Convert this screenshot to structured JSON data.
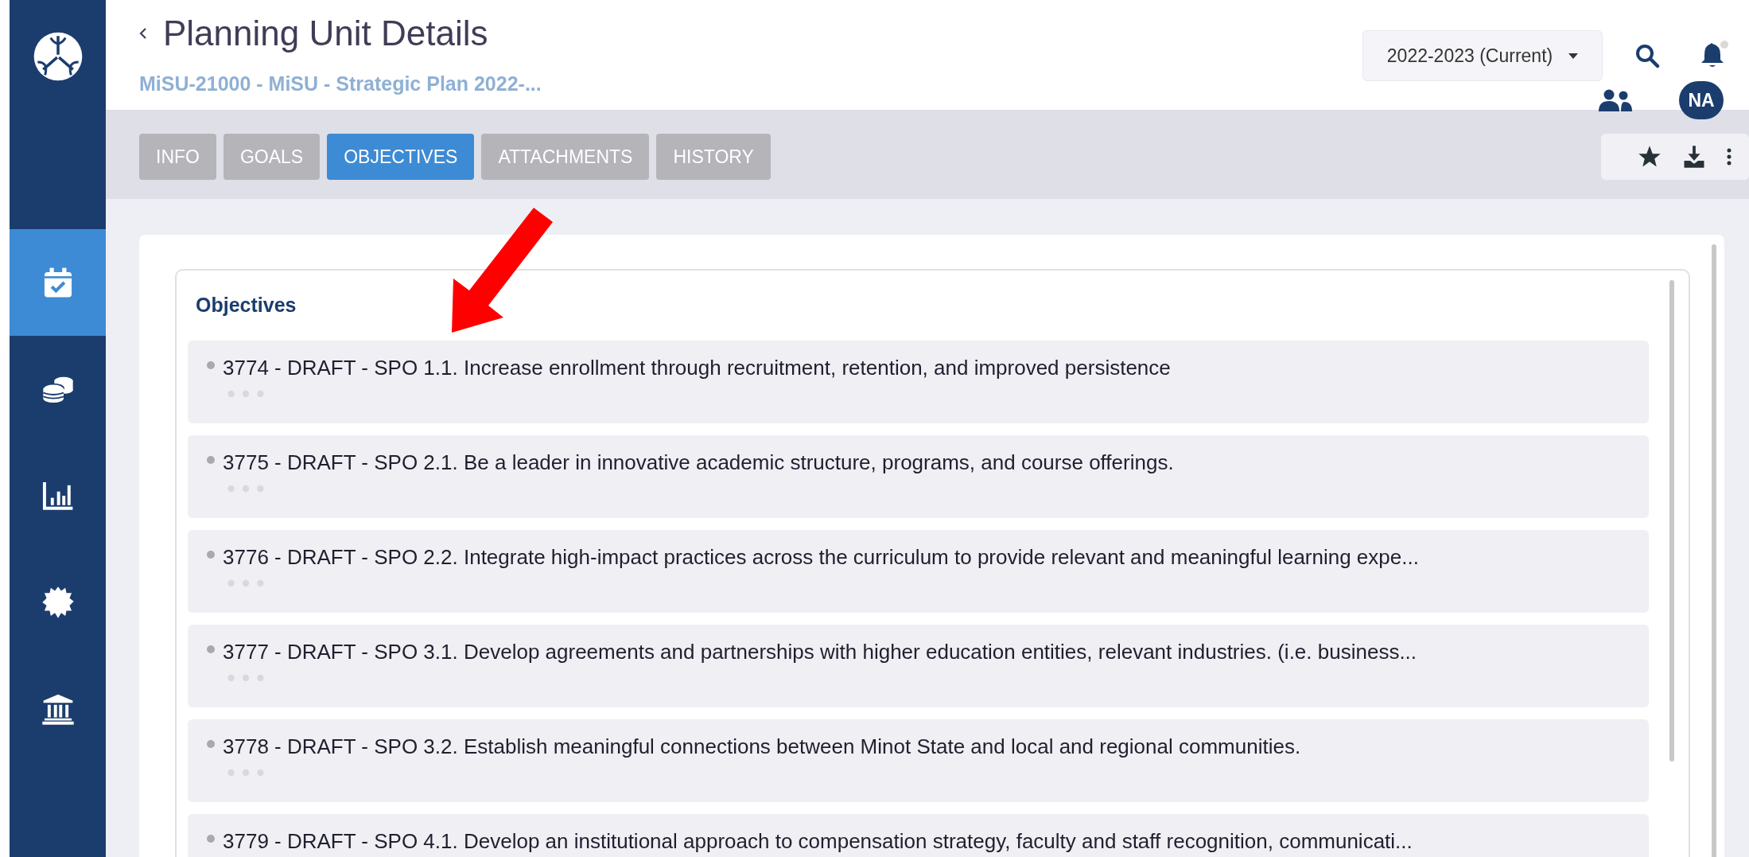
{
  "sidebar": {
    "items": [
      {
        "kind": "calendar",
        "selected": true
      },
      {
        "kind": "coins",
        "selected": false
      },
      {
        "kind": "chart",
        "selected": false
      },
      {
        "kind": "badge",
        "selected": false
      },
      {
        "kind": "bank",
        "selected": false
      }
    ]
  },
  "header": {
    "title": "Planning Unit Details",
    "subtitle": "MiSU-21000 - MiSU - Strategic Plan 2022-..."
  },
  "year_selector": {
    "value": "2022-2023 (Current)"
  },
  "user": {
    "initials": "NA"
  },
  "tabs": [
    {
      "label": "INFO",
      "selected": false
    },
    {
      "label": "GOALS",
      "selected": false
    },
    {
      "label": "OBJECTIVES",
      "selected": true
    },
    {
      "label": "ATTACHMENTS",
      "selected": false
    },
    {
      "label": "HISTORY",
      "selected": false
    }
  ],
  "objectives": {
    "title": "Objectives",
    "items": [
      {
        "text": "3774 - DRAFT - SPO 1.1. Increase enrollment through recruitment, retention, and improved persistence"
      },
      {
        "text": "3775 - DRAFT - SPO 2.1. Be a leader in innovative academic structure, programs, and course offerings."
      },
      {
        "text": "3776 - DRAFT - SPO 2.2. Integrate high-impact practices across the curriculum to provide relevant and meaningful learning expe..."
      },
      {
        "text": "3777 - DRAFT - SPO 3.1. Develop agreements and partnerships with higher education entities, relevant industries. (i.e. business..."
      },
      {
        "text": "3778 - DRAFT - SPO 3.2. Establish meaningful connections between Minot State and local and regional communities."
      },
      {
        "text": "3779 - DRAFT - SPO 4.1. Develop an institutional approach to compensation strategy, faculty and staff recognition, communicati..."
      }
    ]
  }
}
